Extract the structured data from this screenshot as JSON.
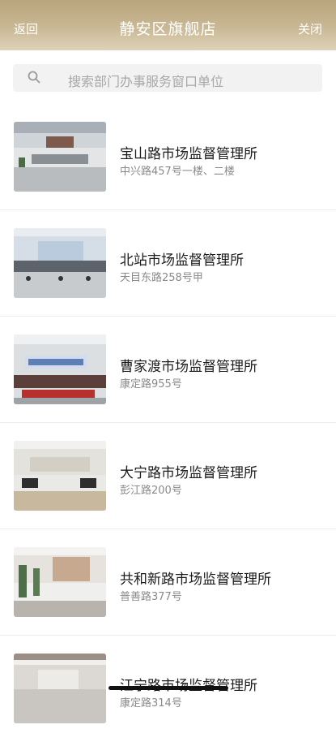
{
  "header": {
    "back_label": "返回",
    "title": "静安区旗舰店",
    "close_label": "关闭"
  },
  "search": {
    "placeholder": "搜索部门办事服务窗口单位"
  },
  "offices": [
    {
      "name": "宝山路市场监督管理所",
      "address": "中兴路457号一楼、二楼"
    },
    {
      "name": "北站市场监督管理所",
      "address": "天目东路258号甲"
    },
    {
      "name": "曹家渡市场监督管理所",
      "address": "康定路955号"
    },
    {
      "name": "大宁路市场监督管理所",
      "address": "彭江路200号"
    },
    {
      "name": "共和新路市场监督管理所",
      "address": "普善路377号"
    },
    {
      "name": "江宁路市场监督管理所",
      "address": "康定路314号"
    }
  ]
}
